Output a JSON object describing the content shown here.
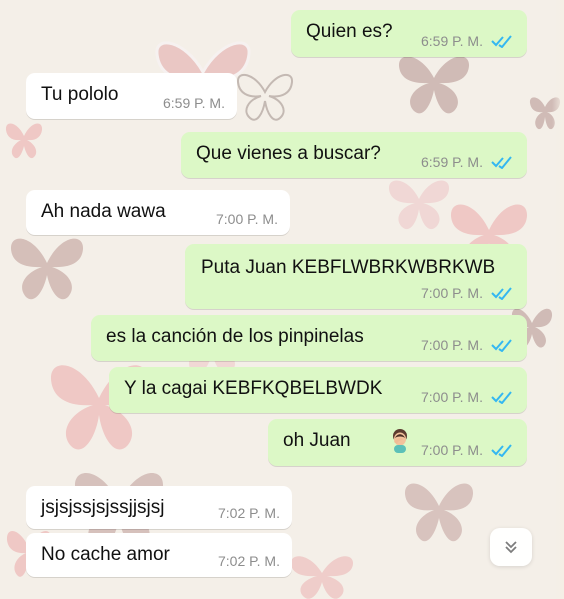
{
  "chat": {
    "messages": [
      {
        "text": "Quien es?",
        "time": "6:59 P. M."
      },
      {
        "text": "Tu pololo",
        "time": "6:59 P. M."
      },
      {
        "text": "Que vienes a buscar?",
        "time": "6:59 P. M."
      },
      {
        "text": "Ah nada wawa",
        "time": "7:00 P. M."
      },
      {
        "text": "Puta Juan KEBFLWBRKWBRKWB",
        "time": "7:00 P. M."
      },
      {
        "text": "es la canción de los pinpinelas",
        "time": "7:00 P. M."
      },
      {
        "text": "Y la cagai KEBFKQBELBWDK",
        "time": "7:00 P. M."
      },
      {
        "text": "oh Juan",
        "time": "7:00 P. M."
      },
      {
        "text": "jsjsjssjsjssjjsjsj",
        "time": "7:02 P. M."
      },
      {
        "text": "No cache amor",
        "time": "7:02 P. M."
      }
    ]
  },
  "icons": {
    "read_receipt": "double-check-icon",
    "emoji": "person-facepalm-emoji-icon",
    "scroll": "chevron-double-down-icon"
  },
  "colors": {
    "wallpaper": "#f4efe8",
    "outgoing": "#dcf8c6",
    "incoming": "#ffffff",
    "meta_text": "#8d8d8d",
    "check_blue": "#34b7f1"
  }
}
